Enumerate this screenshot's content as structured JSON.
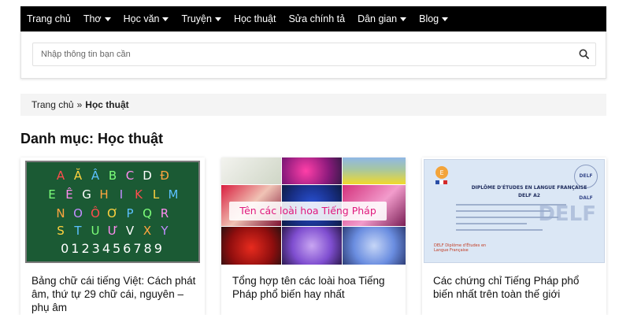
{
  "nav": {
    "items": [
      {
        "label": "Trang chủ",
        "dropdown": false
      },
      {
        "label": "Thơ",
        "dropdown": true
      },
      {
        "label": "Học văn",
        "dropdown": true
      },
      {
        "label": "Truyện",
        "dropdown": true
      },
      {
        "label": "Học thuật",
        "dropdown": false
      },
      {
        "label": "Sửa chính tả",
        "dropdown": false
      },
      {
        "label": "Dân gian",
        "dropdown": true
      },
      {
        "label": "Blog",
        "dropdown": true
      }
    ]
  },
  "search": {
    "placeholder": "Nhập thông tin bạn cần",
    "icon": "search-icon"
  },
  "breadcrumb": {
    "home": "Trang chủ",
    "separator": "»",
    "current": "Học thuật"
  },
  "page": {
    "title": "Danh mục: Học thuật"
  },
  "posts": [
    {
      "title": "Bảng chữ cái tiếng Việt: Cách phát âm, thứ tự 29 chữ cái, nguyên – phụ âm",
      "image": {
        "row1": [
          "A",
          "Ă",
          "Â",
          "B",
          "C",
          "D",
          "Đ"
        ],
        "row2": [
          "E",
          "Ê",
          "G",
          "H",
          "I",
          "K",
          "L",
          "M"
        ],
        "row3": [
          "N",
          "O",
          "Ô",
          "Ơ",
          "P",
          "Q",
          "R"
        ],
        "row4": [
          "S",
          "T",
          "U",
          "Ư",
          "V",
          "X",
          "Y"
        ],
        "digits": "0123456789"
      }
    },
    {
      "title": "Tổng hợp tên các loài hoa Tiếng Pháp phổ biến hay nhất",
      "image": {
        "overlay": "Tên các loài hoa Tiếng Pháp"
      }
    },
    {
      "title": "Các chứng chỉ Tiếng Pháp phổ biến nhất trên toàn thế giới",
      "image": {
        "heading": "DIPLÔME D'ÉTUDES EN LANGUE FRANÇAISE",
        "level": "DELF A2",
        "badge": "DELF DALF",
        "watermark": "DELF",
        "stamp": "DELF Diplôme d'Études en Langue Française"
      }
    }
  ]
}
